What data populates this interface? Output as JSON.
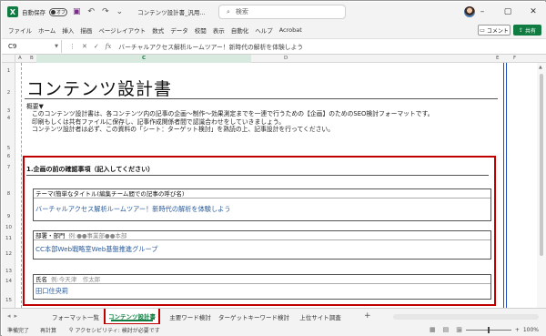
{
  "titlebar": {
    "autosave_label": "自動保存",
    "autosave_state": "オフ",
    "doc_title": "コンテンツ設計書_汎用...",
    "search_placeholder": "検索",
    "icons": [
      "excel-icon",
      "save-icon",
      "undo-icon",
      "redo-icon",
      "customize-icon",
      "search-icon",
      "minimize-icon",
      "restore-icon",
      "close-icon"
    ]
  },
  "ribbon": {
    "tabs": [
      "ファイル",
      "ホーム",
      "挿入",
      "描画",
      "ページレイアウト",
      "数式",
      "データ",
      "校閲",
      "表示",
      "自動化",
      "ヘルプ",
      "Acrobat"
    ],
    "comment_label": "コメント",
    "share_label": "共有"
  },
  "formula_bar": {
    "cell_ref": "C9",
    "fx_label": "fx",
    "value": "バーチャルアクセス解析ルームツアー！新時代の解析を体験しよう"
  },
  "columns": [
    "A",
    "B",
    "C",
    "D",
    "E",
    "F"
  ],
  "rows": [
    "1",
    "2",
    "3",
    "4",
    "5",
    "6",
    "7",
    "8",
    "9",
    "10",
    "11",
    "12",
    "13",
    "14",
    "15"
  ],
  "document": {
    "heading": "コンテンツ設計書",
    "overview_title": "概要▼",
    "overview_lines": [
      "このコンテンツ設計書は、各コンテンツ内の記事の企画～制作～効果測定までを一連で行うための【企画】のためのSEO検討フォーマットです。",
      "印刷もしくは共有ファイルに保存し、記事作成関係者間で認識合わせをしていきましょう。",
      "コンテンツ設計者は必ず、この資料の「シート：ターゲット検討」を熟読の上、記事設計を行ってください。"
    ],
    "section_title": "1.企画の前の確認事項（記入してください）",
    "fields": [
      {
        "label": "テーマ(簡単なタイトル(編集チーム間での記事の呼び名)",
        "hint": "",
        "value": "バーチャルアクセス解析ルームツアー！新時代の解析を体験しよう"
      },
      {
        "label": "部署・部門",
        "hint": "例:●●事業部●●本部",
        "value": "CC本部Web戦略室Web基盤推進グループ"
      },
      {
        "label": "氏名",
        "hint": "例:今天津　作太郎",
        "value": "田口住央莉"
      }
    ]
  },
  "sheet_tabs": {
    "tabs": [
      "フォーマット一覧",
      "コンテンツ設計書",
      "主要ワード検討",
      "ターゲットキーワード検討",
      "上位サイト調査"
    ],
    "active_index": 1,
    "add_label": "+"
  },
  "status_bar": {
    "ready": "準備完了",
    "calc": "再計算",
    "accessibility": "アクセシビリティ: 検討が必要です",
    "zoom": "100%"
  }
}
